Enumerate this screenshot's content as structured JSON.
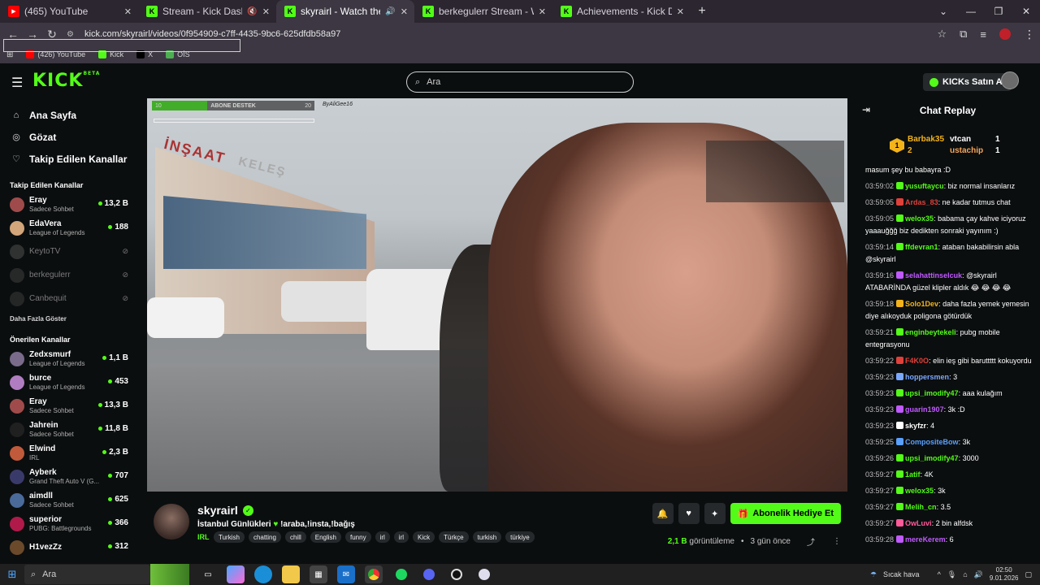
{
  "browser": {
    "tabs": [
      {
        "label": "(465) YouTube",
        "favicon": "youtube-icon",
        "active": false
      },
      {
        "label": "Stream - Kick Dashboard",
        "favicon": "kick-icon",
        "active": false,
        "muted": true
      },
      {
        "label": "skyrairl - Watch the VOD on",
        "favicon": "kick-icon",
        "active": true
      },
      {
        "label": "berkegulerr Stream - Watch Liv",
        "favicon": "kick-icon",
        "active": false
      },
      {
        "label": "Achievements - Kick Dashboard",
        "favicon": "kick-icon",
        "active": false
      }
    ],
    "url": "kick.com/skyrairl/videos/0f954909-c7ff-4435-9bc6-625dfdb58a97",
    "bookmarks": [
      {
        "label": "(426) YouTube",
        "color": "#ff0000"
      },
      {
        "label": "Kick",
        "color": "#53fc18"
      },
      {
        "label": "X",
        "color": "#000000"
      },
      {
        "label": "OİS",
        "color": "#4caf50"
      }
    ]
  },
  "header": {
    "logo": "KICK",
    "logo_badge": "BETA",
    "search_placeholder": "Ara",
    "kicks_button": "KICKs Satın Al"
  },
  "sidebar": {
    "nav": [
      {
        "label": "Ana Sayfa",
        "icon": "home-icon"
      },
      {
        "label": "Gözat",
        "icon": "compass-icon"
      },
      {
        "label": "Takip Edilen Kanallar",
        "icon": "heart-icon"
      }
    ],
    "followed_title": "Takip Edilen Kanallar",
    "followed": [
      {
        "name": "Eray",
        "category": "Sadece Sohbet",
        "viewers": "13,2 B",
        "live": true,
        "color": "#a04b4b"
      },
      {
        "name": "EdaVera",
        "category": "League of Legends",
        "viewers": "188",
        "live": true,
        "color": "#d2a57a"
      },
      {
        "name": "KeytoTV",
        "category": "",
        "viewers": "",
        "live": false,
        "color": "#555555"
      },
      {
        "name": "berkegulerr",
        "category": "",
        "viewers": "",
        "live": false,
        "color": "#444444"
      },
      {
        "name": "Canbequit",
        "category": "",
        "viewers": "",
        "live": false,
        "color": "#3f3f3f"
      }
    ],
    "show_more": "Daha Fazla Göster",
    "recommended_title": "Önerilen Kanallar",
    "recommended": [
      {
        "name": "Zedxsmurf",
        "category": "League of Legends",
        "viewers": "1,1 B",
        "color": "#7a6b8a"
      },
      {
        "name": "burce",
        "category": "League of Legends",
        "viewers": "453",
        "color": "#b07ec0"
      },
      {
        "name": "Eray",
        "category": "Sadece Sohbet",
        "viewers": "13,3 B",
        "color": "#a04b4b"
      },
      {
        "name": "Jahrein",
        "category": "Sadece Sohbet",
        "viewers": "11,8 B",
        "color": "#202020"
      },
      {
        "name": "Elwind",
        "category": "IRL",
        "viewers": "2,3 B",
        "color": "#c05a3a"
      },
      {
        "name": "Ayberk",
        "category": "Grand Theft Auto V (G...",
        "viewers": "707",
        "color": "#3a3a6a"
      },
      {
        "name": "aimdll",
        "category": "Sadece Sohbet",
        "viewers": "625",
        "color": "#4a6a9a"
      },
      {
        "name": "superior",
        "category": "PUBG: Battlegrounds",
        "viewers": "366",
        "color": "#b01a4a"
      },
      {
        "name": "H1vezZz",
        "category": "",
        "viewers": "312",
        "color": "#6a4a2a"
      }
    ]
  },
  "player": {
    "sub_goal_label": "ABONE DESTEK",
    "sub_goal_current": "10",
    "sub_goal_target": "20",
    "sub_goal_fraction": 0.34,
    "watermark": "ByAliGee16"
  },
  "stream": {
    "streamer": "skyrairl",
    "title_prefix": "İstanbul Günlükleri",
    "title_suffix": "!araba,!insta,!bağış",
    "category": "IRL",
    "tags": [
      "Turkish",
      "chatting",
      "chill",
      "English",
      "funny",
      "irl",
      "irl",
      "Kick",
      "Türkçe",
      "turkish",
      "türkiye"
    ],
    "subscribe_gift_label": "Abonelik Hediye Et",
    "views": "2,1 B",
    "views_label": "görüntüleme",
    "ago": "3 gün önce"
  },
  "chat": {
    "title": "Chat Replay",
    "leaders": [
      {
        "rank": "1",
        "name": "Barbak35",
        "count": "2"
      },
      {
        "name": "vtcan",
        "count": "1"
      },
      {
        "name": "ustachip",
        "count": "1"
      }
    ],
    "messages": [
      {
        "time": "",
        "user": "",
        "text": "masum şey bu babayra :D",
        "color": "#ffffff"
      },
      {
        "time": "03:59:02",
        "user": "yusuftaycu",
        "text": "biz normal insanlarız",
        "color": "#53fc18"
      },
      {
        "time": "03:59:05",
        "user": "Ardas_83",
        "text": "ne kadar tutmus chat",
        "color": "#e0403a"
      },
      {
        "time": "03:59:05",
        "user": "welox35",
        "text": "babama çay kahve iciyoruz yaaauğğğ biz dedikten sonraki yayınım :)",
        "color": "#53fc18"
      },
      {
        "time": "03:59:14",
        "user": "ffdevran1",
        "text": "ataban bakabilirsin abla @skyrairl",
        "color": "#53fc18"
      },
      {
        "time": "03:59:16",
        "user": "selahattinselcuk",
        "text": "@skyrairl ATABARİNDA güzel klipler aldık 😂 😂 😂 😂",
        "color": "#c05aff"
      },
      {
        "time": "03:59:18",
        "user": "Solo1Dev",
        "text": "daha fazla yemek yemesin diye alıkoyduk poligona götürdük",
        "color": "#f3b319"
      },
      {
        "time": "03:59:21",
        "user": "enginbeytekeli",
        "text": "pubg mobile entegrasyonu",
        "color": "#53fc18"
      },
      {
        "time": "03:59:22",
        "user": "F4K0O",
        "text": "elin ieş gibi baruttttt kokuyordu",
        "color": "#e0403a"
      },
      {
        "time": "03:59:23",
        "user": "hoppersmen",
        "text": "3",
        "color": "#7aa8ff"
      },
      {
        "time": "03:59:23",
        "user": "upsi_imodify47",
        "text": "aaa kulağım",
        "color": "#53fc18"
      },
      {
        "time": "03:59:23",
        "user": "guarin1907",
        "text": "3k :D",
        "color": "#c05aff"
      },
      {
        "time": "03:59:23",
        "user": "skyfzr",
        "text": "4",
        "color": "#ffffff"
      },
      {
        "time": "03:59:25",
        "user": "CompositeBow",
        "text": "3k",
        "color": "#5aa0ff"
      },
      {
        "time": "03:59:26",
        "user": "upsi_imodify47",
        "text": "3000",
        "color": "#53fc18"
      },
      {
        "time": "03:59:27",
        "user": "1atif",
        "text": "4K",
        "color": "#53fc18"
      },
      {
        "time": "03:59:27",
        "user": "welox35",
        "text": "3k",
        "color": "#53fc18"
      },
      {
        "time": "03:59:27",
        "user": "Melih_cn",
        "text": "3.5",
        "color": "#53fc18"
      },
      {
        "time": "03:59:27",
        "user": "OwLuvi",
        "text": "2 bin alfdsk",
        "color": "#ff5a9a"
      },
      {
        "time": "03:59:28",
        "user": "mereKerem",
        "text": "6",
        "color": "#c05aff"
      }
    ]
  },
  "taskbar": {
    "search_placeholder": "Ara",
    "weather": "Sıcak hava",
    "time": "02:50",
    "date": "9.01.2026"
  }
}
